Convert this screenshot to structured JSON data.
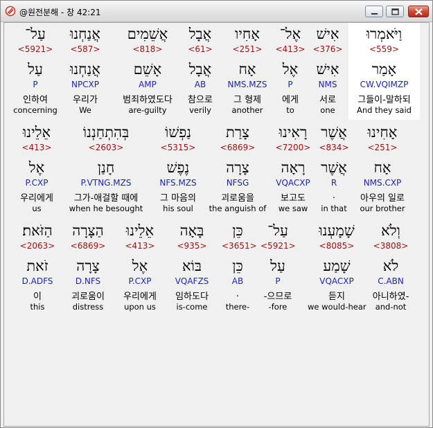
{
  "window": {
    "title": "@원전분해 - 창 42:21",
    "icon": "app-logo-icon",
    "controls": [
      "minimize-icon",
      "maximize-icon",
      "close-icon"
    ]
  },
  "verses": [
    {
      "words": [
        {
          "word": "וַיֹּאמְרוּ",
          "strong": "<559>",
          "lemma": "אָמַר",
          "parse": "CW.VQIMZP",
          "korean": "그들이-말하되",
          "english": "And they said",
          "selected": true
        },
        {
          "word": "אִישׁ",
          "strong": "<376>",
          "lemma": "אִישׁ",
          "parse": "NMS",
          "korean": "서로",
          "english": "one"
        },
        {
          "word": "אֶל־",
          "strong": "<413>",
          "lemma": "אֶל",
          "parse": "P",
          "korean": "에게",
          "english": "to"
        },
        {
          "word": "אָחִיו",
          "strong": "<251>",
          "lemma": "אָח",
          "parse": "NMS.MZS",
          "korean": "그 형제",
          "english": "another"
        },
        {
          "word": "אֲבָל",
          "strong": "<61>",
          "lemma": "אֲבָל",
          "parse": "AB",
          "korean": "참으로",
          "english": "verily"
        },
        {
          "word": "אֲשֵׁמִים",
          "strong": "<818>",
          "lemma": "אָשֵׁם",
          "parse": "AMP",
          "korean": "범죄하였도다",
          "english": "are-guilty"
        },
        {
          "word": "אֲנַחְנוּ",
          "strong": "<587>",
          "lemma": "אֲנַחְנוּ",
          "parse": "NPCXP",
          "korean": "우리가",
          "english": "We"
        },
        {
          "word": "עַל־",
          "strong": "<5921>",
          "lemma": "עַל",
          "parse": "P",
          "korean": "인하여",
          "english": "concerning"
        }
      ]
    },
    {
      "words": [
        {
          "word": "אָחִינוּ",
          "strong": "<251>",
          "lemma": "אָח",
          "parse": "NMS.CXP",
          "korean": "아우의 일로",
          "english": "our brother"
        },
        {
          "word": "אֲשֶׁר",
          "strong": "<834>",
          "lemma": "אֲשֶׁר",
          "parse": "R",
          "korean": ".",
          "english": "in that"
        },
        {
          "word": "רָאִינוּ",
          "strong": "<7200>",
          "lemma": "רָאָה",
          "parse": "VQACXP",
          "korean": "보고도",
          "english": "we saw"
        },
        {
          "word": "צָרַת",
          "strong": "<6869>",
          "lemma": "צָרָה",
          "parse": "NFSG",
          "korean": "괴로움을",
          "english": "the anguish of"
        },
        {
          "word": "נַפְשׁוֹ",
          "strong": "<5315>",
          "lemma": "נֶפֶשׁ",
          "parse": "NFS.MZS",
          "korean": "그 마음의",
          "english": "his soul"
        },
        {
          "word": "בְּהִתְחַנְנוֹ",
          "strong": "<2603>",
          "lemma": "חָנַן",
          "parse": "P.VTNG.MZS",
          "korean": "그가-애걸할 때에",
          "english": "when he besought"
        },
        {
          "word": "אֵלֵינוּ",
          "strong": "<413>",
          "lemma": "אֶל",
          "parse": "P.CXP",
          "korean": "우리에게",
          "english": "us"
        }
      ]
    },
    {
      "words": [
        {
          "word": "וְלֹא",
          "strong": "<3808>",
          "lemma": "לֹא",
          "parse": "C.ABN",
          "korean": "아니하였-",
          "english": "and-not"
        },
        {
          "word": "שָׁמָעְנוּ",
          "strong": "<8085>",
          "lemma": "שָׁמַע",
          "parse": "VQACXP",
          "korean": "듣지",
          "english": "we would-hear"
        },
        {
          "word": "עַל־",
          "strong": "<5921>",
          "lemma": "עַל",
          "parse": "P",
          "korean": "-으므로",
          "english": "-fore"
        },
        {
          "word": "כֵּן",
          "strong": "<3651>",
          "lemma": "כֵּן",
          "parse": "AB",
          "korean": ".",
          "english": "there-"
        },
        {
          "word": "בָּאָה",
          "strong": "<935>",
          "lemma": "בּוֹא",
          "parse": "VQAFZS",
          "korean": "임하도다",
          "english": "is-come"
        },
        {
          "word": "אֵלֵינוּ",
          "strong": "<413>",
          "lemma": "אֶל",
          "parse": "P.CXP",
          "korean": "우리에게",
          "english": "upon us"
        },
        {
          "word": "הַצָּרָה",
          "strong": "<6869>",
          "lemma": "צָרָה",
          "parse": "D.NFS",
          "korean": "괴로움이",
          "english": "distress"
        },
        {
          "word": "הַזֹּאת׃",
          "strong": "<2063>",
          "lemma": "זֹאת",
          "parse": "D.ADFS",
          "korean": "이",
          "english": "this"
        }
      ]
    }
  ]
}
